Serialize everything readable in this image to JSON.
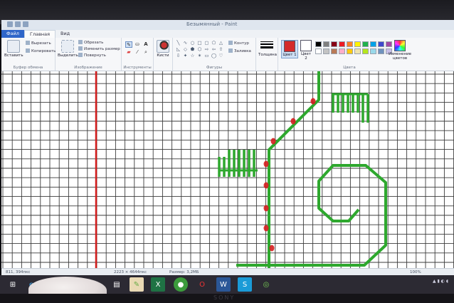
{
  "bezel": {
    "brand_top": "",
    "brand_bottom": "SONY"
  },
  "window": {
    "title": "Безымянный - Paint"
  },
  "ribbon_tabs": [
    {
      "label": "Файл"
    },
    {
      "label": "Главная"
    },
    {
      "label": "Вид"
    }
  ],
  "clipboard": {
    "paste": "Вставить",
    "cut": "Вырезать",
    "copy": "Копировать",
    "group": "Буфер обмена"
  },
  "image": {
    "select": "Выделить",
    "crop": "Обрезать",
    "resize": "Изменить размер",
    "rotate": "Повернуть",
    "group": "Изображение"
  },
  "tools": {
    "group": "Инструменты",
    "text_tool": "A"
  },
  "brushes": {
    "label": "Кисти"
  },
  "shapes": {
    "outline": "Контур",
    "fill": "Заливка",
    "group": "Фигуры"
  },
  "size": {
    "label": "Толщина"
  },
  "colors": {
    "color1": "Цвет 1",
    "color2": "Цвет 2",
    "edit": "Изменение цветов",
    "group": "Цвета",
    "color1_value": "#d42a2a",
    "color2_value": "#ffffff",
    "palette": [
      "#000000",
      "#7f7f7f",
      "#880015",
      "#ed1c24",
      "#ff7f27",
      "#fff200",
      "#22b14c",
      "#00a2e8",
      "#3f48cc",
      "#a349a4",
      "#ffffff",
      "#c3c3c3",
      "#b97a57",
      "#ffaec9",
      "#ffc90e",
      "#efe4b0",
      "#b5e61d",
      "#99d9ea",
      "#7092be",
      "#c8bfe7"
    ]
  },
  "canvas": {
    "stroke_green": "#2ea82e",
    "stroke_red": "#d41d1d"
  },
  "status": {
    "position": "811, 394пкс",
    "selection": "2223 × 4644пкс",
    "size": "Размер: 3,2МБ",
    "zoom": "100%"
  },
  "taskbar": {
    "icons": [
      "windows-icon",
      "ie-icon",
      "explorer-icon",
      "paint-icon",
      "excel-icon",
      "chrome-icon",
      "opera-icon",
      "word-icon",
      "skype-icon",
      "browser-icon"
    ]
  }
}
